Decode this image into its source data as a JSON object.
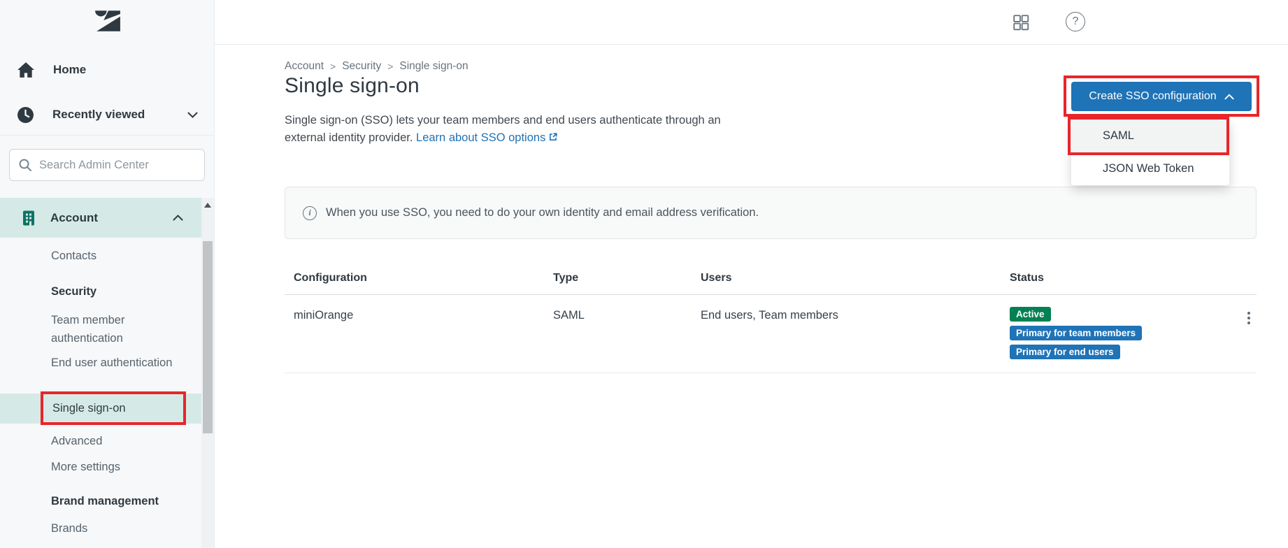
{
  "sidebar": {
    "home_label": "Home",
    "recently_viewed_label": "Recently viewed",
    "search_placeholder": "Search Admin Center",
    "section_label": "Account",
    "items": [
      {
        "label": "Contacts",
        "type": "item"
      },
      {
        "label": "Security",
        "type": "header"
      },
      {
        "label": "Team member authentication",
        "type": "item"
      },
      {
        "label": "End user authentication",
        "type": "item"
      },
      {
        "label": "Single sign-on",
        "type": "item",
        "selected": true
      },
      {
        "label": "Advanced",
        "type": "item"
      },
      {
        "label": "More settings",
        "type": "item"
      },
      {
        "label": "Brand management",
        "type": "header"
      },
      {
        "label": "Brands",
        "type": "item"
      }
    ]
  },
  "header": {
    "help_glyph": "?",
    "icons": [
      "apps-grid-icon",
      "help-icon"
    ]
  },
  "breadcrumb": [
    "Account",
    "Security",
    "Single sign-on"
  ],
  "breadcrumb_separator": ">",
  "page": {
    "title": "Single sign-on",
    "description_line1": "Single sign-on (SSO) lets your team members and end users authenticate through an",
    "description_line2": "external identity provider.",
    "link_label": "Learn about SSO options"
  },
  "create_button": {
    "label": "Create SSO configuration"
  },
  "dropdown": {
    "items": [
      "SAML",
      "JSON Web Token"
    ]
  },
  "banner": {
    "text": "When you use SSO, you need to do your own identity and email address verification."
  },
  "table": {
    "columns": [
      "Configuration",
      "Type",
      "Users",
      "Status"
    ],
    "rows": [
      {
        "configuration": "miniOrange",
        "type": "SAML",
        "users": "End users, Team members",
        "badges": [
          {
            "label": "Active",
            "color": "#038153"
          },
          {
            "label": "Primary for team members",
            "color": "#1f73b7"
          },
          {
            "label": "Primary for end users",
            "color": "#1f73b7"
          }
        ]
      }
    ]
  },
  "colors": {
    "accent_blue": "#1f73b7",
    "success_green": "#038153",
    "annotation_red": "#e8262a",
    "sidebar_selected_teal": "#d5eae6",
    "account_icon_teal": "#0e7265"
  }
}
